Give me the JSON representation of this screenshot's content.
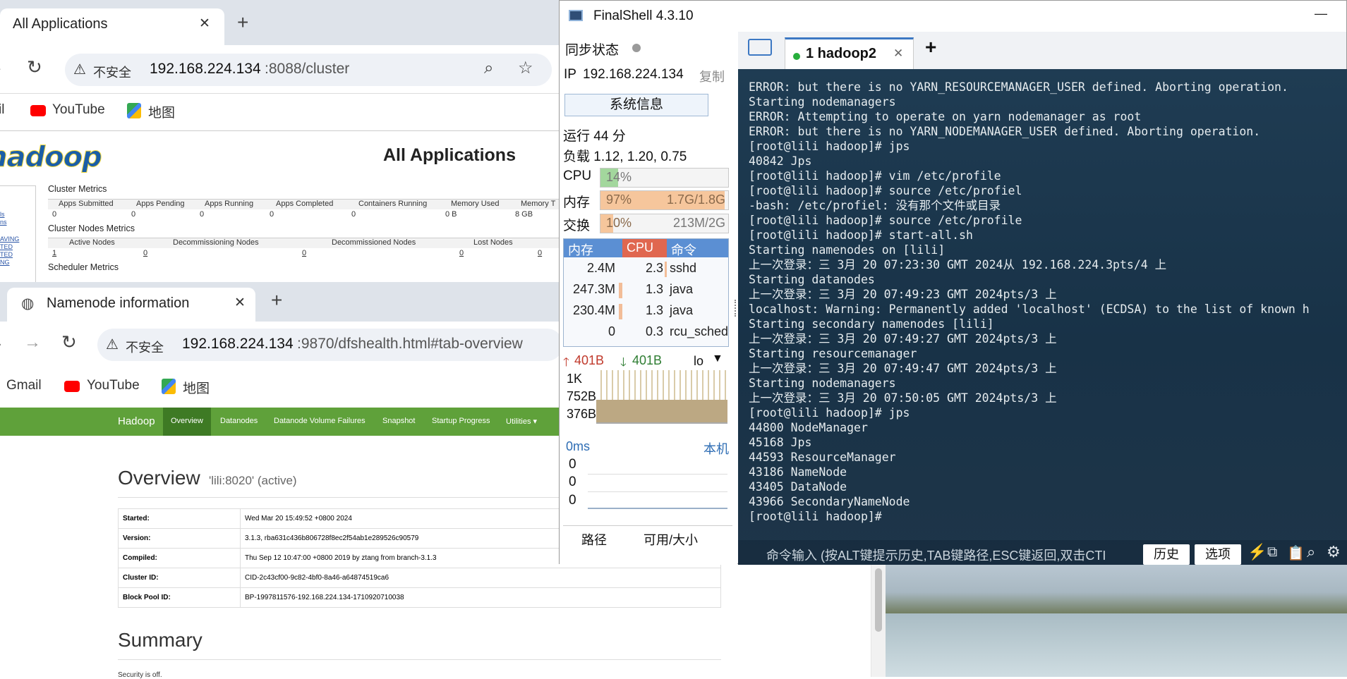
{
  "browser1": {
    "tab_title": "All Applications",
    "tab_close": "✕",
    "new_tab": "+",
    "insecure_label": "不安全",
    "url_host": "192.168.224.134",
    "url_rest": ":8088/cluster",
    "bookmarks": [
      {
        "label": "il"
      },
      {
        "label": "YouTube"
      },
      {
        "label": "地图"
      }
    ],
    "logo_text": "hadoop",
    "page_title": "All Applications",
    "cluster_metrics_title": "Cluster Metrics",
    "cluster_metrics_headers": [
      "Apps Submitted",
      "Apps Pending",
      "Apps Running",
      "Apps Completed",
      "Containers Running",
      "Memory Used",
      "Memory T"
    ],
    "cluster_metrics_values": [
      "0",
      "0",
      "0",
      "0",
      "0",
      "0 B",
      "8 GB"
    ],
    "nodes_metrics_title": "Cluster Nodes Metrics",
    "nodes_metrics_headers": [
      "Active Nodes",
      "Decommissioning Nodes",
      "Decommissioned Nodes",
      "Lost Nodes"
    ],
    "nodes_metrics_values": [
      "1",
      "0",
      "0",
      "0",
      "0"
    ],
    "scheduler_metrics_title": "Scheduler Metrics",
    "side_links": [
      "ls",
      "ns",
      "AVING",
      "TED",
      "TED",
      "NG"
    ]
  },
  "browser2": {
    "tab_title": "Namenode information",
    "tab_close": "✕",
    "new_tab": "+",
    "insecure_label": "不安全",
    "url_host": "192.168.224.134",
    "url_rest": ":9870/dfshealth.html#tab-overview",
    "bookmarks": [
      {
        "label": "Gmail"
      },
      {
        "label": "YouTube"
      },
      {
        "label": "地图"
      }
    ],
    "nav": [
      "Hadoop",
      "Overview",
      "Datanodes",
      "Datanode Volume Failures",
      "Snapshot",
      "Startup Progress",
      "Utilities ▾"
    ],
    "overview_title": "Overview",
    "overview_sub": "'lili:8020' (active)",
    "overview_rows": [
      {
        "k": "Started:",
        "v": "Wed Mar 20 15:49:52 +0800 2024"
      },
      {
        "k": "Version:",
        "v": "3.1.3, rba631c436b806728f8ec2f54ab1e289526c90579"
      },
      {
        "k": "Compiled:",
        "v": "Thu Sep 12 10:47:00 +0800 2019 by ztang from branch-3.1.3"
      },
      {
        "k": "Cluster ID:",
        "v": "CID-2c43cf00-9c82-4bf0-8a46-a64874519ca6"
      },
      {
        "k": "Block Pool ID:",
        "v": "BP-1997811576-192.168.224.134-1710920710038"
      }
    ],
    "summary_title": "Summary",
    "security_text": "Security is off."
  },
  "finalshell": {
    "title": "FinalShell 4.3.10",
    "minimize": "—",
    "sync_label": "同步状态",
    "ip_label": "IP",
    "ip_value": "192.168.224.134",
    "copy_label": "复制",
    "sysinfo_button": "系统信息",
    "uptime": "运行 44 分",
    "load": "负载 1.12, 1.20, 0.75",
    "cpu_label": "CPU",
    "cpu_value": "14%",
    "cpu_fraction": 0.14,
    "mem_label": "内存",
    "mem_pct": "97%",
    "mem_value": "1.7G/1.8G",
    "mem_fraction": 0.97,
    "swap_label": "交换",
    "swap_pct": "10%",
    "swap_value": "213M/2G",
    "swap_fraction": 0.1,
    "proc_headers": [
      "内存",
      "CPU",
      "命令"
    ],
    "processes": [
      {
        "mem": "2.4M",
        "cpu": "2.3",
        "cmd": "sshd"
      },
      {
        "mem": "247.3M",
        "cpu": "1.3",
        "cmd": "java"
      },
      {
        "mem": "230.4M",
        "cpu": "1.3",
        "cmd": "java"
      },
      {
        "mem": "0",
        "cpu": "0.3",
        "cmd": "rcu_sched"
      }
    ],
    "net_up": "401B",
    "net_down": "401B",
    "net_iface": "lo",
    "net_scale": [
      "1K",
      "752B",
      "376B"
    ],
    "latency_label": "0ms",
    "latency_host": "本机",
    "latency_values": [
      "0",
      "0",
      "0"
    ],
    "disk_headers": [
      "路径",
      "可用/大小"
    ],
    "session_tab": "1 hadoop2",
    "session_close": "✕",
    "add_tab": "+",
    "terminal_lines": [
      "ERROR: but there is no YARN_RESOURCEMANAGER_USER defined. Aborting operation.",
      "Starting nodemanagers",
      "ERROR: Attempting to operate on yarn nodemanager as root",
      "ERROR: but there is no YARN_NODEMANAGER_USER defined. Aborting operation.",
      "[root@lili hadoop]# jps",
      "40842 Jps",
      "[root@lili hadoop]# vim /etc/profile",
      "[root@lili hadoop]# source /etc/profiel",
      "-bash: /etc/profiel: 没有那个文件或目录",
      "[root@lili hadoop]# source /etc/profile",
      "[root@lili hadoop]# start-all.sh",
      "Starting namenodes on [lili]",
      "上一次登录：三 3月 20 07:23:30 GMT 2024从 192.168.224.3pts/4 上",
      "Starting datanodes",
      "上一次登录：三 3月 20 07:49:23 GMT 2024pts/3 上",
      "localhost: Warning: Permanently added 'localhost' (ECDSA) to the list of known h",
      "Starting secondary namenodes [lili]",
      "上一次登录：三 3月 20 07:49:27 GMT 2024pts/3 上",
      "Starting resourcemanager",
      "上一次登录：三 3月 20 07:49:47 GMT 2024pts/3 上",
      "Starting nodemanagers",
      "上一次登录：三 3月 20 07:50:05 GMT 2024pts/3 上",
      "[root@lili hadoop]# jps",
      "44800 NodeManager",
      "45168 Jps",
      "44593 ResourceManager",
      "43186 NameNode",
      "43405 DataNode",
      "43966 SecondaryNameNode",
      "[root@lili hadoop]#"
    ],
    "cmd_placeholder": "命令输入 (按ALT键提示历史,TAB键路径,ESC键返回,双击CTI",
    "history_button": "历史",
    "options_button": "选项"
  },
  "colors": {
    "hadoop_green": "#5fa13a",
    "terminal_bg": "#1b354b",
    "mem_bar": "#f6c69c",
    "cpu_bar": "#9fd39a",
    "proc_header_blue": "#5b8fd3",
    "proc_header_red": "#e0674f"
  }
}
